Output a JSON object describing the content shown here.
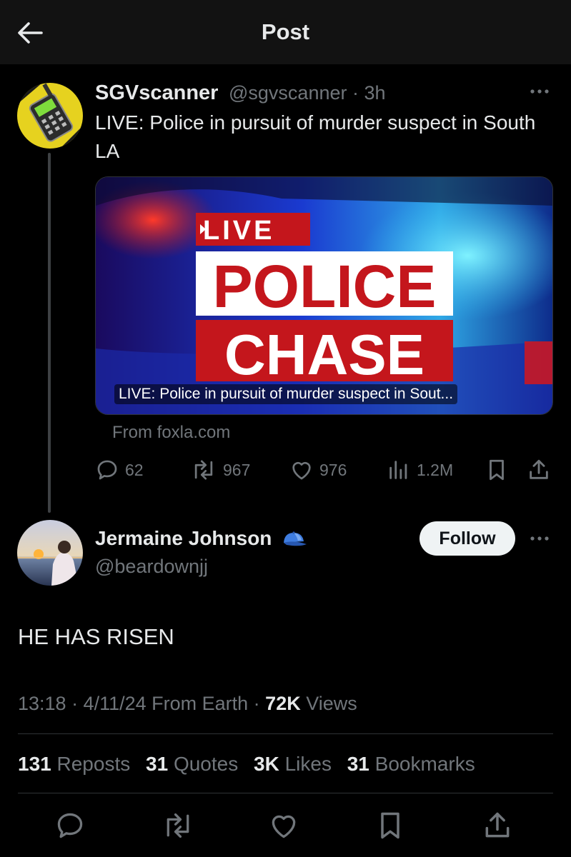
{
  "header": {
    "title": "Post",
    "back_icon": "arrow-left-icon"
  },
  "quoted_post": {
    "author_name": "SGVscanner",
    "author_handle_time": "@sgvscanner · 3h",
    "text": "LIVE: Police in pursuit of murder suspect in South LA",
    "card": {
      "badge": "LIVE",
      "headline_line1": "POLICE",
      "headline_line2": "CHASE",
      "caption": "LIVE: Police in pursuit of murder suspect in Sout...",
      "source": "From foxla.com"
    },
    "actions": {
      "replies": "62",
      "reposts": "967",
      "likes": "976",
      "views": "1.2M"
    }
  },
  "main_post": {
    "author_name": "Jermaine Johnson",
    "author_handle": "@beardownjj",
    "follow_label": "Follow",
    "text": "HE HAS RISEN",
    "meta": {
      "time_date_source": "13:18 · 4/11/24 From Earth · ",
      "views_count": "72K",
      "views_label": " Views"
    },
    "stats": [
      {
        "num": "131",
        "label": "Reposts"
      },
      {
        "num": "31",
        "label": "Quotes"
      },
      {
        "num": "3K",
        "label": "Likes"
      },
      {
        "num": "31",
        "label": "Bookmarks"
      }
    ]
  },
  "colors": {
    "background": "#000000",
    "header_bg": "#121212",
    "text_primary": "#e7e9ea",
    "text_secondary": "#71767b",
    "divider": "#2f3336",
    "follow_bg": "#eff3f4",
    "badge_red": "#c4161c"
  }
}
